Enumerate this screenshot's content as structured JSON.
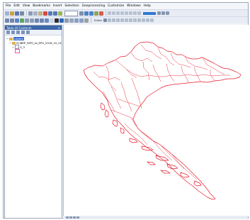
{
  "menu": [
    "File",
    "Edit",
    "View",
    "Bookmarks",
    "Insert",
    "Selection",
    "Geoprocessing",
    "Customize",
    "Windows",
    "Help"
  ],
  "toolbar": {
    "scale": "",
    "editor": "Editor"
  },
  "toc": {
    "title": "Table Of Contents",
    "root": "Layers",
    "layer_path": "D:\\BRP_SHP\\_ta_EPU_2018_10_01",
    "layer_name": "0_3"
  },
  "colors": {
    "map_line": "#e31d2b",
    "selection": "#3b6fd1",
    "toc_header": "#3d67a8"
  }
}
